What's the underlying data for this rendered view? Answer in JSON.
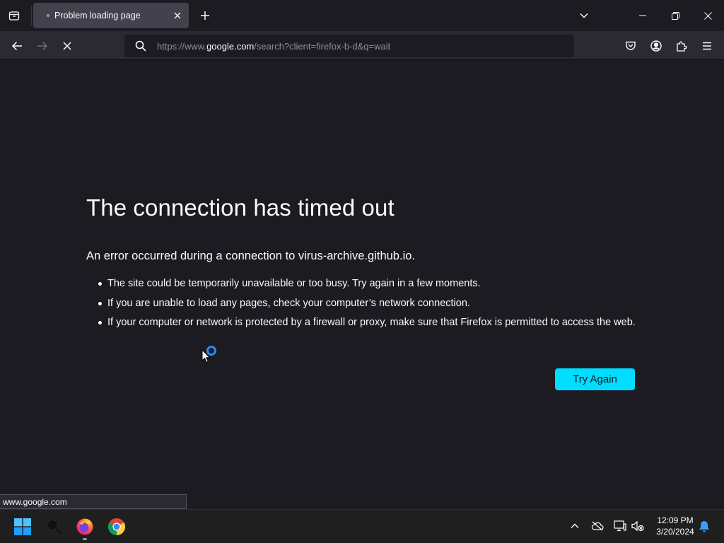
{
  "browser": {
    "tab": {
      "title": "Problem loading page"
    },
    "url": {
      "prefix": "https://www.",
      "domain": "google.com",
      "suffix": "/search?client=firefox-b-d&q=wait"
    },
    "status_link": "www.google.com"
  },
  "error_page": {
    "title": "The connection has timed out",
    "description": "An error occurred during a connection to virus-archive.github.io.",
    "bullets": [
      "The site could be temporarily unavailable or too busy. Try again in a few moments.",
      "If you are unable to load any pages, check your computer’s network connection.",
      "If your computer or network is protected by a firewall or proxy, make sure that Firefox is permitted to access the web."
    ],
    "try_again_label": "Try Again"
  },
  "taskbar": {
    "time": "12:09 PM",
    "date": "3/20/2024"
  },
  "colors": {
    "accent": "#00ddff",
    "page_background": "#1c1b22",
    "toolbar": "#2b2a33"
  },
  "icons": [
    "tab-list-icon",
    "close-icon",
    "plus-icon",
    "chevron-down-icon",
    "minimize-icon",
    "restore-icon",
    "back-arrow-icon",
    "forward-arrow-icon",
    "stop-icon",
    "search-icon",
    "pocket-icon",
    "account-icon",
    "extensions-icon",
    "menu-icon",
    "windows-start-icon",
    "search-icon",
    "firefox-icon",
    "chrome-icon",
    "chevron-up-icon",
    "cloud-off-icon",
    "network-icon",
    "volume-muted-icon",
    "bell-icon"
  ]
}
